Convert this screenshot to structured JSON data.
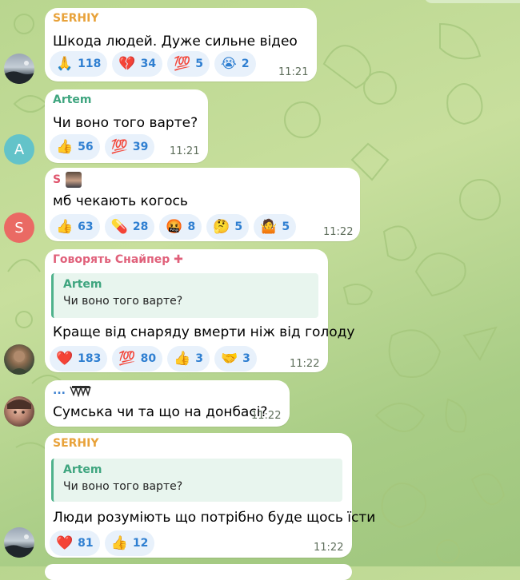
{
  "messages": [
    {
      "sender": "SERHIY",
      "sender_color": "#e8a23a",
      "text": "Шкода людей. Дуже сильне відео",
      "time": "11:21",
      "reactions": [
        {
          "emoji": "🙏",
          "icon": "pray-icon",
          "count": "118"
        },
        {
          "emoji": "💔",
          "icon": "broken-heart-icon",
          "count": "34"
        },
        {
          "emoji": "💯",
          "icon": "hundred-icon",
          "count": "5"
        },
        {
          "emoji": "😭",
          "icon": "crying-face-icon",
          "count": "2"
        }
      ]
    },
    {
      "sender": "Artem",
      "sender_color": "#3fa57f",
      "avatar_letter": "A",
      "avatar_color": "#63c3c9",
      "text": "Чи воно того варте?",
      "time": "11:21",
      "reactions": [
        {
          "emoji": "👍",
          "icon": "thumbs-up-icon",
          "count": "56"
        },
        {
          "emoji": "💯",
          "icon": "hundred-icon",
          "count": "39"
        }
      ]
    },
    {
      "sender": "S",
      "sender_color": "#e0566e",
      "avatar_letter": "S",
      "avatar_color": "#ea6a64",
      "text": "мб чекають когось",
      "time": "11:22",
      "reactions": [
        {
          "emoji": "👍",
          "icon": "thumbs-up-icon",
          "count": "63"
        },
        {
          "emoji": "💊",
          "icon": "pill-icon",
          "count": "28"
        },
        {
          "emoji": "🤬",
          "icon": "angry-face-icon",
          "count": "8"
        },
        {
          "emoji": "🤔",
          "icon": "thinking-face-icon",
          "count": "5"
        },
        {
          "emoji": "🤷",
          "icon": "shrug-icon",
          "count": "5"
        }
      ]
    },
    {
      "sender": "Говорять Снайпер ✚",
      "sender_color": "#e0607a",
      "reply_name": "Artem",
      "reply_text": "Чи воно того варте?",
      "text": "Краще від снаряду вмерти ніж від голоду",
      "time": "11:22",
      "reactions": [
        {
          "emoji": "❤️",
          "icon": "heart-icon",
          "count": "183"
        },
        {
          "emoji": "💯",
          "icon": "hundred-icon",
          "count": "80"
        },
        {
          "emoji": "👍",
          "icon": "thumbs-up-icon",
          "count": "3"
        },
        {
          "emoji": "🤝",
          "icon": "handshake-icon",
          "count": "3"
        }
      ]
    },
    {
      "sender": "...",
      "sender_color": "#3b7fd0",
      "text": "Сумська чи та що на донбасі?",
      "time": "11:22"
    },
    {
      "sender": "SERHIY",
      "sender_color": "#e8a23a",
      "reply_name": "Artem",
      "reply_text": "Чи воно того варте?",
      "text": "Люди розуміють що потрібно буде щось їсти",
      "time": "11:22",
      "reactions": [
        {
          "emoji": "❤️",
          "icon": "heart-icon",
          "count": "81"
        },
        {
          "emoji": "👍",
          "icon": "thumbs-up-icon",
          "count": "12"
        }
      ]
    }
  ]
}
